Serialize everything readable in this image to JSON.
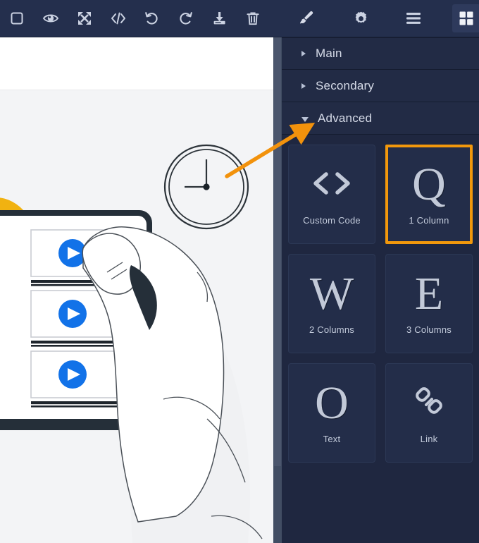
{
  "toolbar": {
    "buttons": [
      {
        "name": "frame-icon",
        "label": "Frame"
      },
      {
        "name": "preview-eye-icon",
        "label": "Preview"
      },
      {
        "name": "fullscreen-icon",
        "label": "Fullscreen"
      },
      {
        "name": "code-icon",
        "label": "Code"
      },
      {
        "name": "undo-icon",
        "label": "Undo"
      },
      {
        "name": "redo-icon",
        "label": "Redo"
      },
      {
        "name": "download-icon",
        "label": "Download"
      },
      {
        "name": "trash-icon",
        "label": "Delete"
      },
      {
        "name": "brush-icon",
        "label": "Styles"
      },
      {
        "name": "gear-icon",
        "label": "Settings"
      },
      {
        "name": "layers-icon",
        "label": "Layer Manager"
      },
      {
        "name": "blocks-grid-icon",
        "label": "Blocks",
        "active": true
      }
    ]
  },
  "sidebar": {
    "sections": [
      {
        "label": "Main",
        "expanded": false
      },
      {
        "label": "Secondary",
        "expanded": false
      },
      {
        "label": "Advanced",
        "expanded": true
      }
    ],
    "blocks": [
      {
        "label": "Custom Code",
        "glyph": "",
        "icon": "angle-brackets-icon",
        "selected": false
      },
      {
        "label": "1 Column",
        "glyph": "Q",
        "icon": "",
        "selected": true
      },
      {
        "label": "2 Columns",
        "glyph": "W",
        "icon": "",
        "selected": false
      },
      {
        "label": "3 Columns",
        "glyph": "E",
        "icon": "",
        "selected": false
      },
      {
        "label": "Text",
        "glyph": "O",
        "icon": "",
        "selected": false
      },
      {
        "label": "Link",
        "glyph": "",
        "icon": "chain-link-icon",
        "selected": false
      }
    ]
  },
  "canvas": {
    "illustration_name": "hand-tapping-video-playlist-with-clock"
  },
  "colors": {
    "toolbar_bg": "#242f4d",
    "sidebar_bg": "#1f2740",
    "tile_bg": "#232d49",
    "accent_orange": "#f2980c",
    "text_light": "#d6dbe8",
    "canvas_bg": "#f3f4f6",
    "play_blue": "#1272e8",
    "illustration_dark": "#222c35",
    "illustration_yellow": "#f1b211"
  }
}
